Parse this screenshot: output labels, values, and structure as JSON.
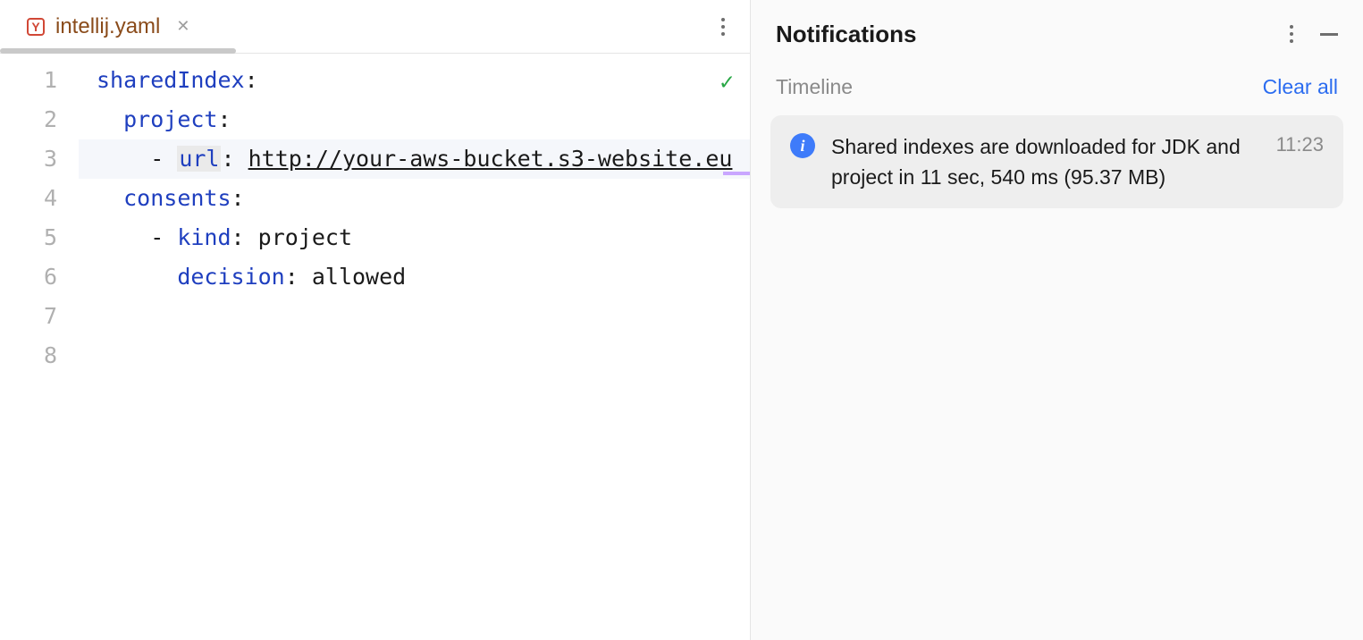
{
  "tab": {
    "icon_letter": "Y",
    "filename": "intellij.yaml"
  },
  "gutter": {
    "lines": [
      "1",
      "2",
      "3",
      "4",
      "5",
      "6",
      "7",
      "8"
    ]
  },
  "code": {
    "l1": {
      "key": "sharedIndex",
      "colon": ":"
    },
    "l2": {
      "indent": "  ",
      "key": "project",
      "colon": ":"
    },
    "l3": {
      "indent": "    ",
      "dash": "- ",
      "key": "url",
      "colon": ": ",
      "url": "http://your-aws-bucket.s3-website.eu"
    },
    "l4": {
      "indent": "  ",
      "key": "consents",
      "colon": ":"
    },
    "l5": {
      "indent": "    ",
      "dash": "- ",
      "key": "kind",
      "colon": ": ",
      "val": "project"
    },
    "l6": {
      "indent": "      ",
      "key": "decision",
      "colon": ": ",
      "val": "allowed"
    }
  },
  "status": {
    "check": "✓"
  },
  "notifications": {
    "title": "Notifications",
    "timeline_label": "Timeline",
    "clear_all": "Clear all",
    "items": [
      {
        "message": "Shared indexes are downloaded for JDK and project in 11 sec, 540 ms (95.37 MB)",
        "time": "11:23"
      }
    ]
  }
}
